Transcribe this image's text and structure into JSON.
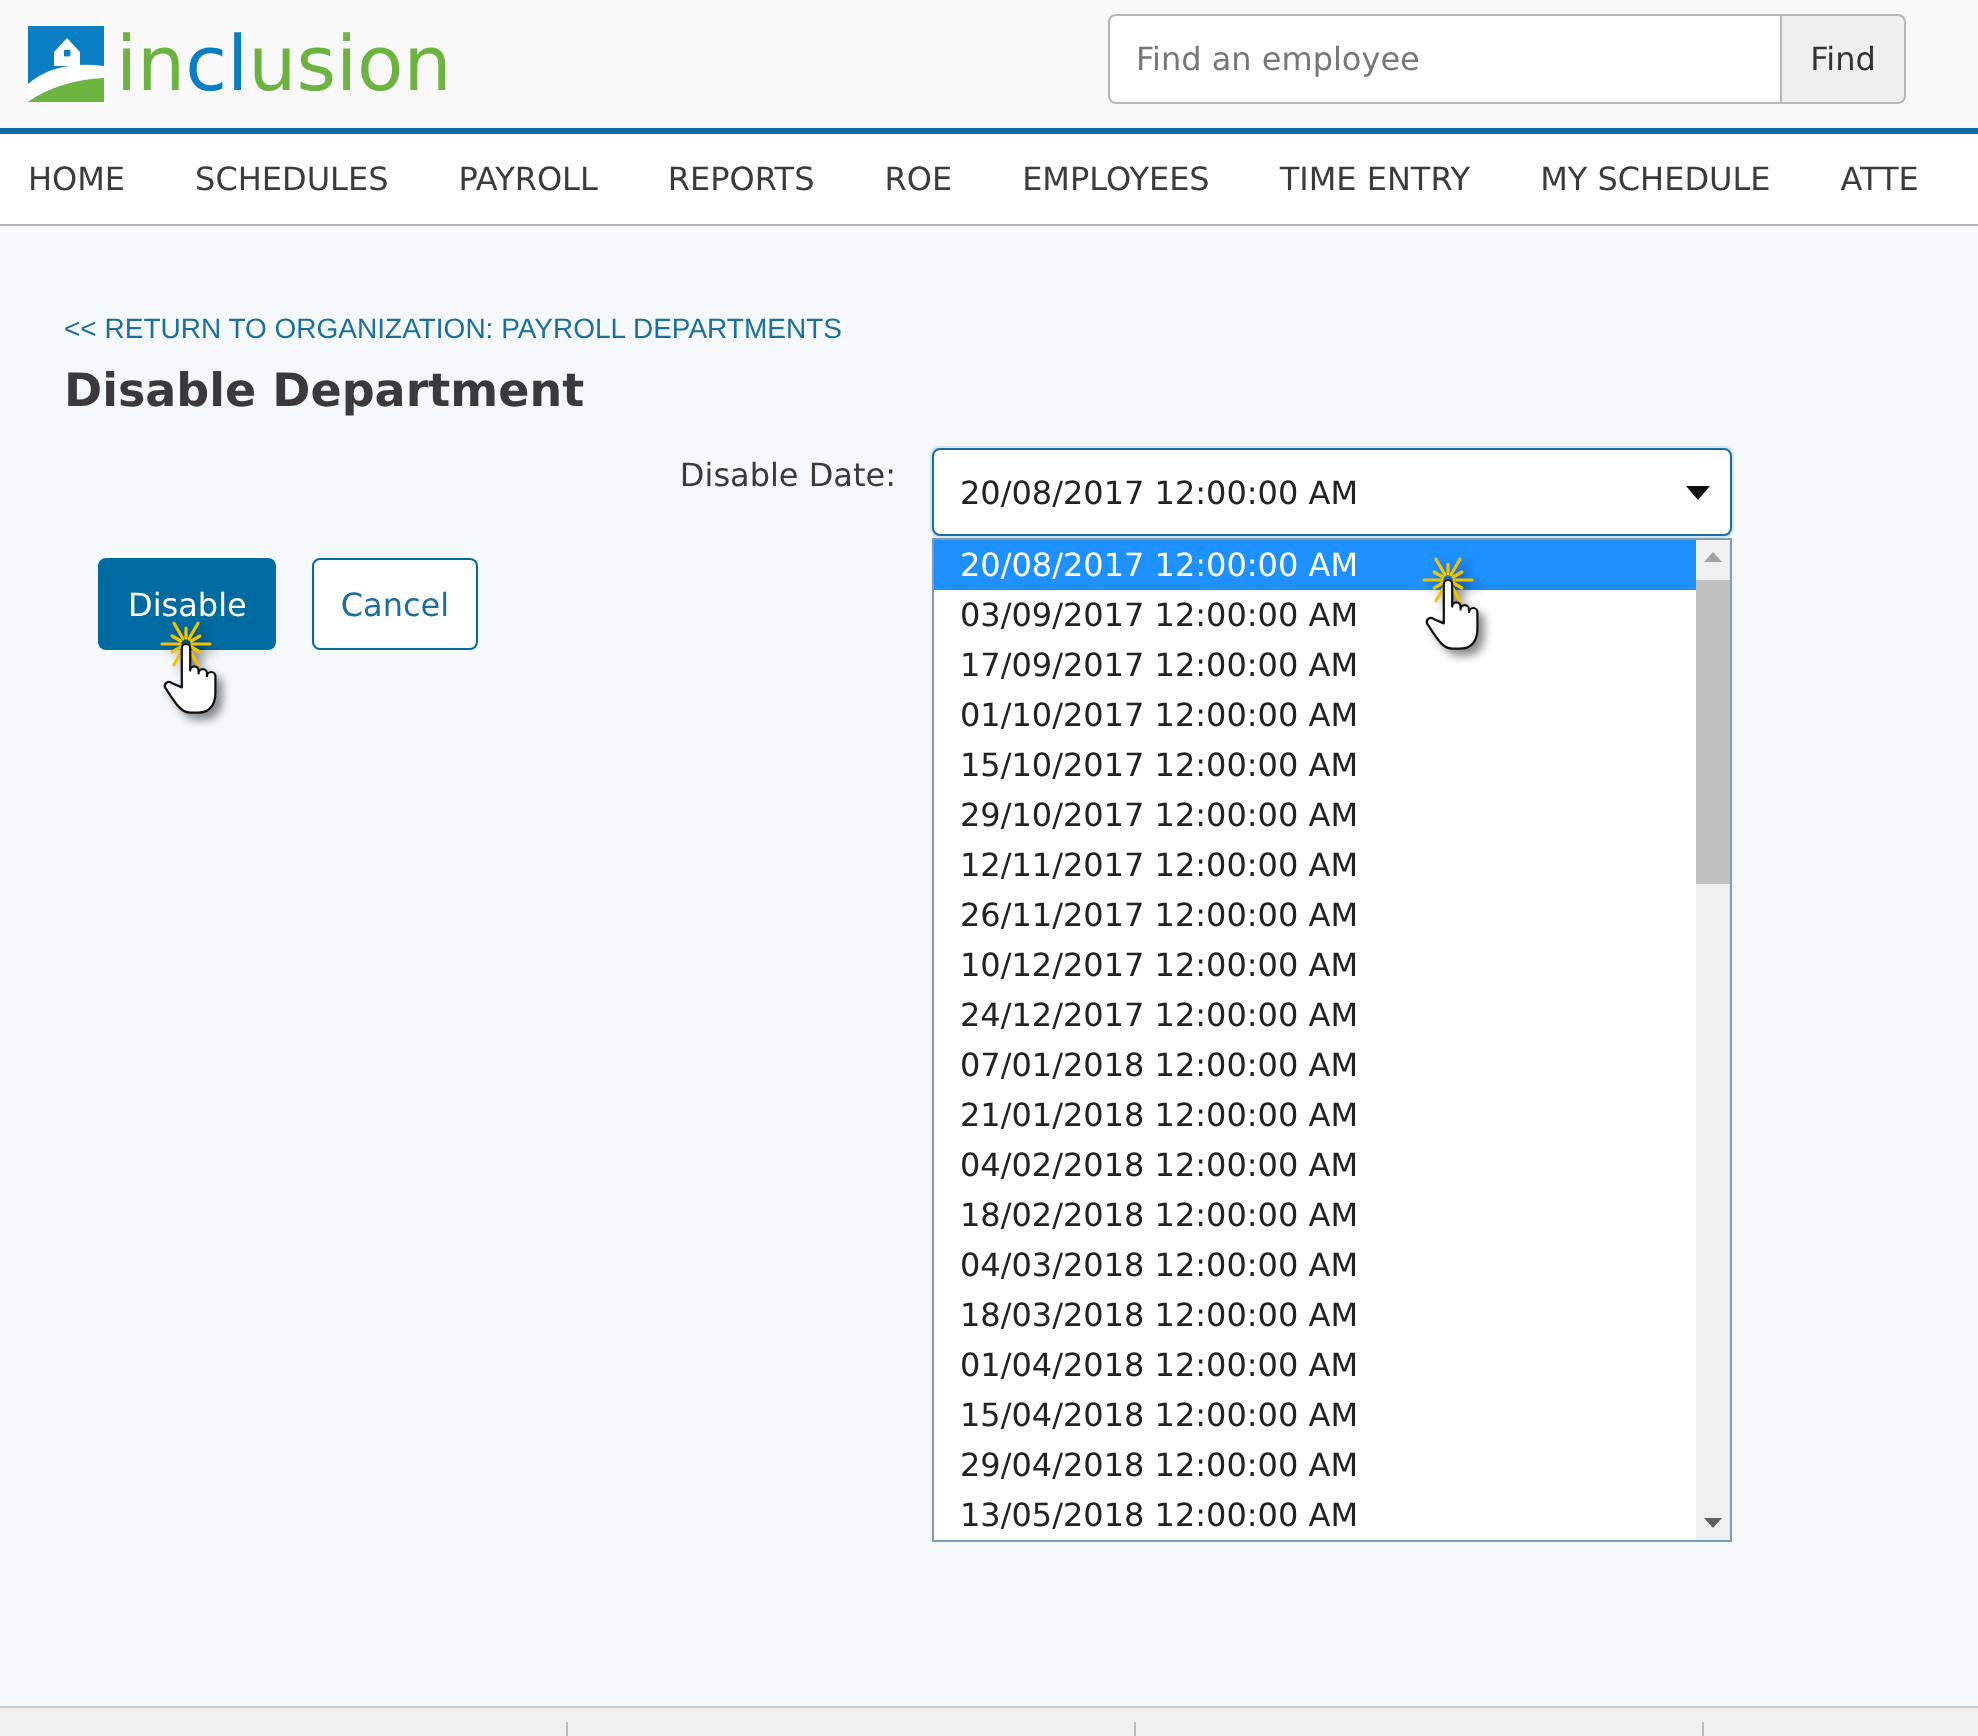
{
  "header": {
    "logo": {
      "segments": [
        {
          "text": "in",
          "color": "#6cb33f"
        },
        {
          "text": "cl",
          "color": "#0a7ec2"
        },
        {
          "text": "usion",
          "color": "#6cb33f"
        }
      ]
    },
    "search": {
      "placeholder": "Find an employee",
      "button": "Find"
    }
  },
  "nav": {
    "items": [
      "HOME",
      "SCHEDULES",
      "PAYROLL",
      "REPORTS",
      "ROE",
      "EMPLOYEES",
      "TIME ENTRY",
      "MY SCHEDULE",
      "ATTE"
    ]
  },
  "breadcrumb": "<< RETURN TO ORGANIZATION: PAYROLL DEPARTMENTS",
  "title": "Disable Department",
  "form": {
    "label": "Disable Date:",
    "select": {
      "value": "20/08/2017 12:00:00 AM",
      "expanded": true,
      "options": [
        {
          "label": "20/08/2017 12:00:00 AM",
          "selected": true
        },
        {
          "label": "03/09/2017 12:00:00 AM",
          "selected": false
        },
        {
          "label": "17/09/2017 12:00:00 AM",
          "selected": false
        },
        {
          "label": "01/10/2017 12:00:00 AM",
          "selected": false
        },
        {
          "label": "15/10/2017 12:00:00 AM",
          "selected": false
        },
        {
          "label": "29/10/2017 12:00:00 AM",
          "selected": false
        },
        {
          "label": "12/11/2017 12:00:00 AM",
          "selected": false
        },
        {
          "label": "26/11/2017 12:00:00 AM",
          "selected": false
        },
        {
          "label": "10/12/2017 12:00:00 AM",
          "selected": false
        },
        {
          "label": "24/12/2017 12:00:00 AM",
          "selected": false
        },
        {
          "label": "07/01/2018 12:00:00 AM",
          "selected": false
        },
        {
          "label": "21/01/2018 12:00:00 AM",
          "selected": false
        },
        {
          "label": "04/02/2018 12:00:00 AM",
          "selected": false
        },
        {
          "label": "18/02/2018 12:00:00 AM",
          "selected": false
        },
        {
          "label": "04/03/2018 12:00:00 AM",
          "selected": false
        },
        {
          "label": "18/03/2018 12:00:00 AM",
          "selected": false
        },
        {
          "label": "01/04/2018 12:00:00 AM",
          "selected": false
        },
        {
          "label": "15/04/2018 12:00:00 AM",
          "selected": false
        },
        {
          "label": "29/04/2018 12:00:00 AM",
          "selected": false
        },
        {
          "label": "13/05/2018 12:00:00 AM",
          "selected": false
        }
      ]
    }
  },
  "buttons": [
    {
      "label": "Disable",
      "kind": "primary"
    },
    {
      "label": "Cancel",
      "kind": "secondary"
    }
  ]
}
